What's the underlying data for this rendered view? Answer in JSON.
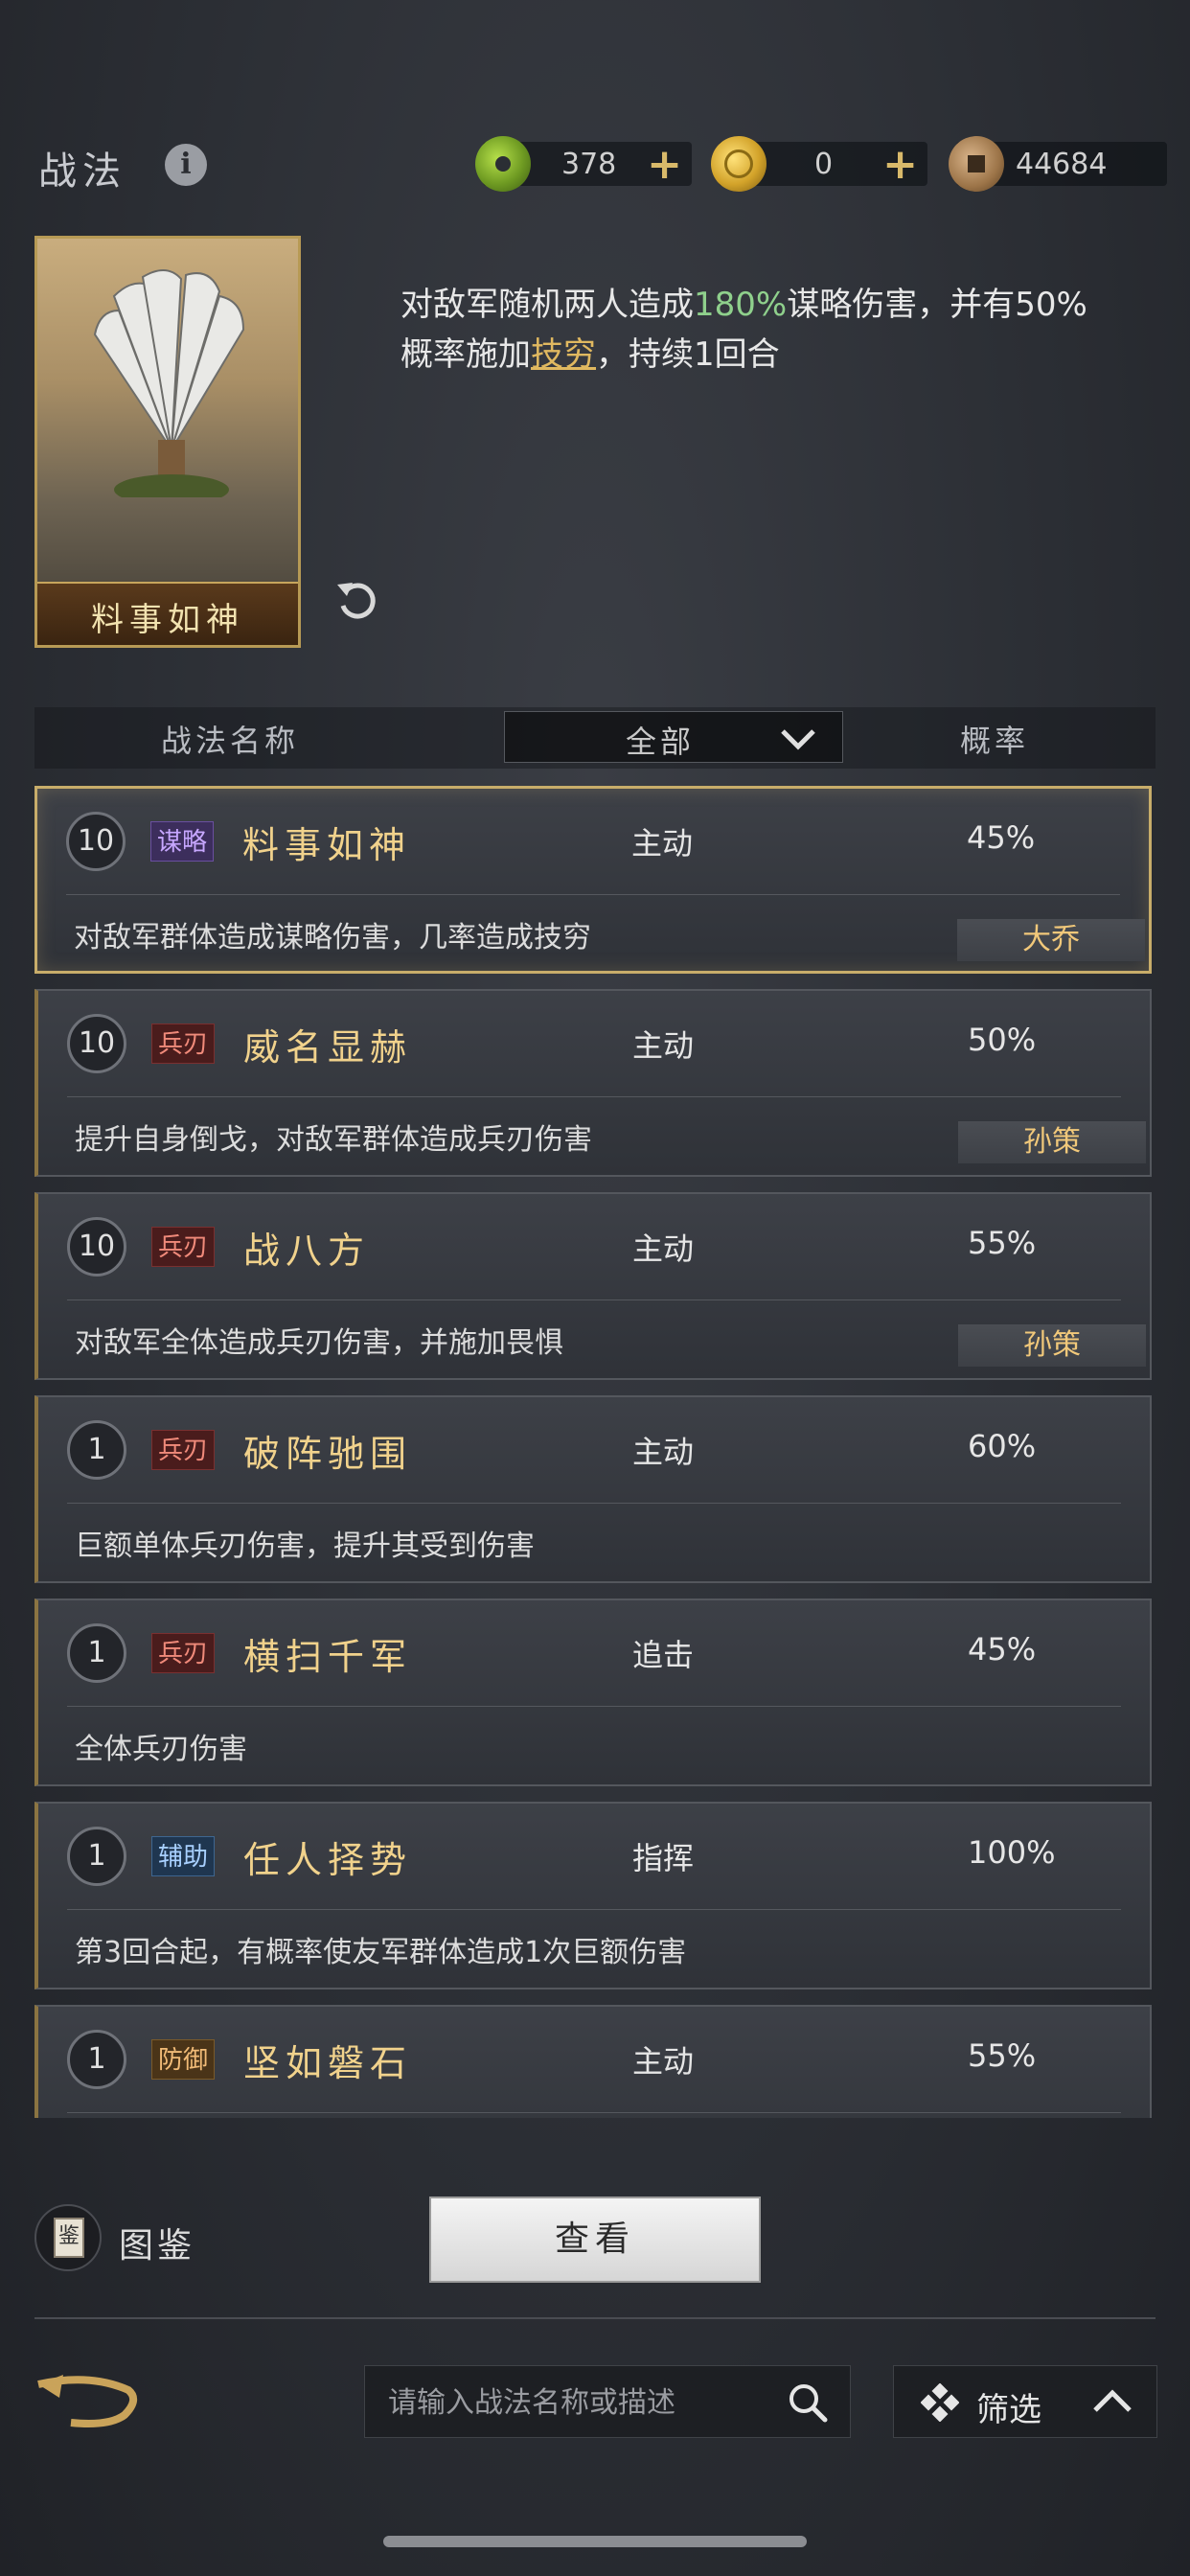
{
  "header": {
    "title": "战法",
    "currencies": [
      {
        "name": "jade",
        "value": "378",
        "has_plus": true
      },
      {
        "name": "gold",
        "value": "0",
        "has_plus": true
      },
      {
        "name": "copper",
        "value": "44684",
        "has_plus": false
      }
    ]
  },
  "detail": {
    "card_name": "料事如神",
    "description": {
      "part1": "对敌军随机两人造成",
      "highlight": "180%",
      "part2": "谋略伤害，并有50%概率施加",
      "status": "技穷",
      "part3": "，持续1回合"
    }
  },
  "list_header": {
    "name_col": "战法名称",
    "filter_value": "全部",
    "rate_col": "概率"
  },
  "skills": [
    {
      "level": "10",
      "tag": "谋略",
      "name": "料事如神",
      "type": "主动",
      "rate": "45%",
      "desc": "对敌军群体造成谋略伤害，几率造成技穷",
      "owner": "大乔"
    },
    {
      "level": "10",
      "tag": "兵刃",
      "name": "威名显赫",
      "type": "主动",
      "rate": "50%",
      "desc": "提升自身倒戈，对敌军群体造成兵刃伤害",
      "owner": "孙策"
    },
    {
      "level": "10",
      "tag": "兵刃",
      "name": "战八方",
      "type": "主动",
      "rate": "55%",
      "desc": "对敌军全体造成兵刃伤害，并施加畏惧",
      "owner": "孙策"
    },
    {
      "level": "1",
      "tag": "兵刃",
      "name": "破阵驰围",
      "type": "主动",
      "rate": "60%",
      "desc": "巨额单体兵刃伤害，提升其受到伤害",
      "owner": ""
    },
    {
      "level": "1",
      "tag": "兵刃",
      "name": "横扫千军",
      "type": "追击",
      "rate": "45%",
      "desc": "全体兵刃伤害",
      "owner": ""
    },
    {
      "level": "1",
      "tag": "辅助",
      "name": "任人择势",
      "type": "指挥",
      "rate": "100%",
      "desc": "第3回合起，有概率使友军群体造成1次巨额伤害",
      "owner": ""
    },
    {
      "level": "1",
      "tag": "防御",
      "name": "坚如磐石",
      "type": "主动",
      "rate": "55%",
      "desc": "",
      "owner": ""
    }
  ],
  "bottom": {
    "codex_label": "图鉴",
    "codex_glyph": "鉴",
    "view_button": "查看",
    "search_placeholder": "请输入战法名称或描述",
    "filter_label": "筛选"
  },
  "colors": {
    "accent_gold": "#c8ad6a",
    "highlight_green": "#8fd08c",
    "owner_text": "#f1c87a"
  }
}
